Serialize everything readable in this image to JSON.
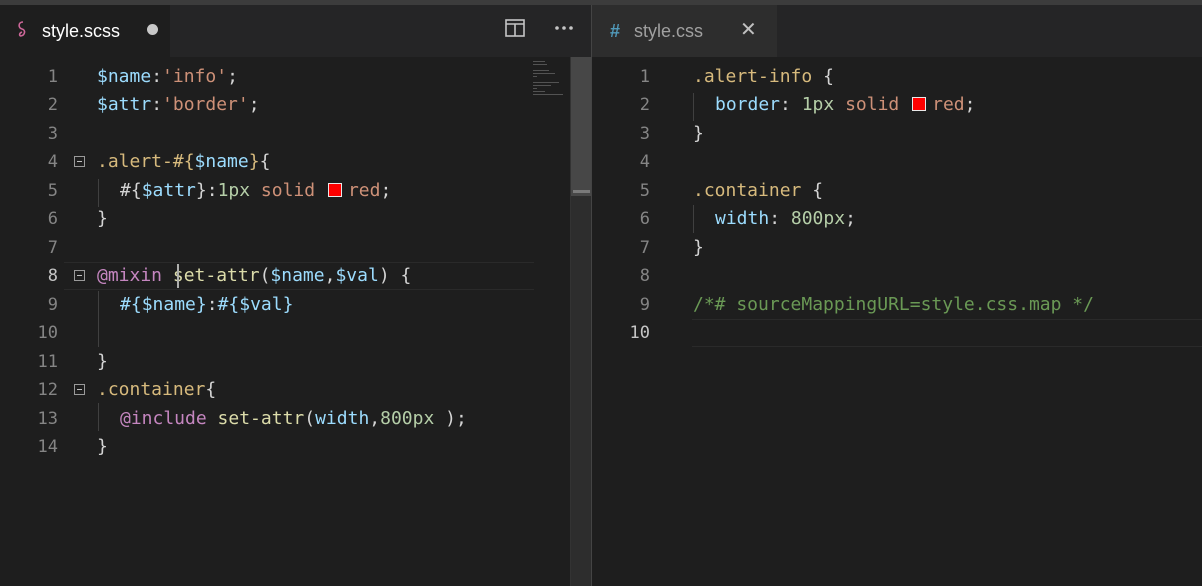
{
  "left_editor": {
    "tab": {
      "label": "style.scss",
      "icon": "sass-file-icon",
      "icon_color": "#cd6799",
      "dirty": true
    },
    "actions": [
      "split-editor-icon",
      "more-actions-icon"
    ],
    "line_numbers": [
      "1",
      "2",
      "3",
      "4",
      "5",
      "6",
      "7",
      "8",
      "9",
      "10",
      "11",
      "12",
      "13",
      "14"
    ],
    "current_line": "8",
    "lines": {
      "l1": {
        "var": "$name",
        "colon": ":",
        "str": "'info'",
        "end": ";"
      },
      "l2": {
        "var": "$attr",
        "colon": ":",
        "str": "'border'",
        "end": ";"
      },
      "l4": {
        "sel": ".alert-#{",
        "var": "$name",
        "close": "}",
        "brace": "{"
      },
      "l5": {
        "open": "#{",
        "var": "$attr",
        "close": "}",
        "colon": ":",
        "num": "1px",
        "value": "solid",
        "color": "red",
        "end": ";"
      },
      "l6": {
        "brace": "}"
      },
      "l8": {
        "at": "@mixin",
        "fn": "set-attr",
        "open": "(",
        "var1": "$name",
        "comma": ",",
        "var2": "$val",
        "close": ")",
        "brace": "{"
      },
      "l9": {
        "open1": "#{",
        "var1": "$name",
        "close1": "}",
        "colon": ":",
        "open2": "#{",
        "var2": "$val",
        "close2": "}"
      },
      "l11": {
        "brace": "}"
      },
      "l12": {
        "sel": ".container",
        "brace": "{"
      },
      "l13": {
        "at": "@include",
        "fn": "set-attr",
        "open": "(",
        "arg": "width",
        "comma": ",",
        "num": "800px",
        "close": " );"
      },
      "l14": {
        "brace": "}"
      }
    }
  },
  "right_editor": {
    "tab": {
      "label": "style.css",
      "icon": "css-file-icon",
      "icon_color": "#519aba",
      "close": "✕"
    },
    "line_numbers": [
      "1",
      "2",
      "3",
      "4",
      "5",
      "6",
      "7",
      "8",
      "9",
      "10"
    ],
    "current_line": "10",
    "lines": {
      "l1": {
        "sel": ".alert-info",
        "brace": "{"
      },
      "l2": {
        "prop": "border",
        "colon": ":",
        "num": "1px",
        "value": "solid",
        "color": "red",
        "end": ";"
      },
      "l3": {
        "brace": "}"
      },
      "l5": {
        "sel": ".container",
        "brace": "{"
      },
      "l6": {
        "prop": "width",
        "colon": ":",
        "num": "800px",
        "end": ";"
      },
      "l7": {
        "brace": "}"
      },
      "l9": {
        "comment": "/*# sourceMappingURL=style.css.map */"
      }
    }
  },
  "colors": {
    "background": "#1e1e1e",
    "variable": "#9cdcfe",
    "string": "#ce9178",
    "selector": "#d7ba7d",
    "keyword": "#c586c0",
    "function": "#dcdcaa",
    "number": "#b5cea8",
    "comment": "#6a9955",
    "swatch": "#ff0000"
  }
}
